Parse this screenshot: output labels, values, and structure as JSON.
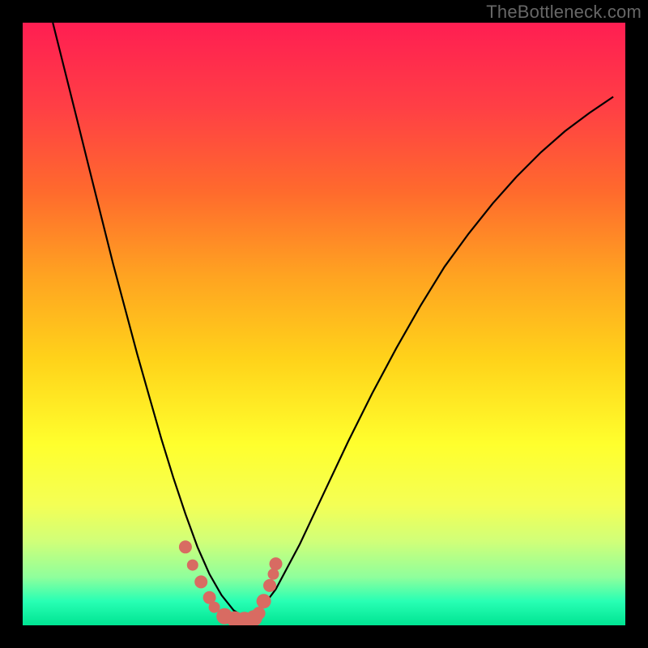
{
  "watermark": "TheBottleneck.com",
  "chart_data": {
    "type": "line",
    "title": "",
    "xlabel": "",
    "ylabel": "",
    "xlim": [
      0,
      1
    ],
    "ylim": [
      0,
      1
    ],
    "series": [
      {
        "name": "curve",
        "x": [
          0.05,
          0.07,
          0.09,
          0.11,
          0.13,
          0.15,
          0.17,
          0.19,
          0.21,
          0.23,
          0.25,
          0.27,
          0.29,
          0.31,
          0.33,
          0.35,
          0.37,
          0.39,
          0.42,
          0.46,
          0.5,
          0.54,
          0.58,
          0.62,
          0.66,
          0.7,
          0.74,
          0.78,
          0.82,
          0.86,
          0.9,
          0.94,
          0.98
        ],
        "y": [
          1.0,
          0.92,
          0.84,
          0.76,
          0.68,
          0.6,
          0.525,
          0.45,
          0.38,
          0.31,
          0.245,
          0.185,
          0.13,
          0.085,
          0.05,
          0.025,
          0.012,
          0.02,
          0.06,
          0.135,
          0.22,
          0.305,
          0.385,
          0.46,
          0.53,
          0.595,
          0.65,
          0.7,
          0.745,
          0.785,
          0.82,
          0.85,
          0.877
        ]
      }
    ],
    "markers": [
      {
        "x": 0.27,
        "y": 0.13,
        "r": 8
      },
      {
        "x": 0.282,
        "y": 0.1,
        "r": 7
      },
      {
        "x": 0.296,
        "y": 0.072,
        "r": 8
      },
      {
        "x": 0.31,
        "y": 0.046,
        "r": 8
      },
      {
        "x": 0.318,
        "y": 0.03,
        "r": 7
      },
      {
        "x": 0.335,
        "y": 0.015,
        "r": 10
      },
      {
        "x": 0.352,
        "y": 0.01,
        "r": 10
      },
      {
        "x": 0.368,
        "y": 0.009,
        "r": 10
      },
      {
        "x": 0.384,
        "y": 0.012,
        "r": 10
      },
      {
        "x": 0.392,
        "y": 0.02,
        "r": 8
      },
      {
        "x": 0.4,
        "y": 0.04,
        "r": 9
      },
      {
        "x": 0.41,
        "y": 0.066,
        "r": 8
      },
      {
        "x": 0.416,
        "y": 0.085,
        "r": 7
      },
      {
        "x": 0.42,
        "y": 0.102,
        "r": 8
      }
    ]
  }
}
